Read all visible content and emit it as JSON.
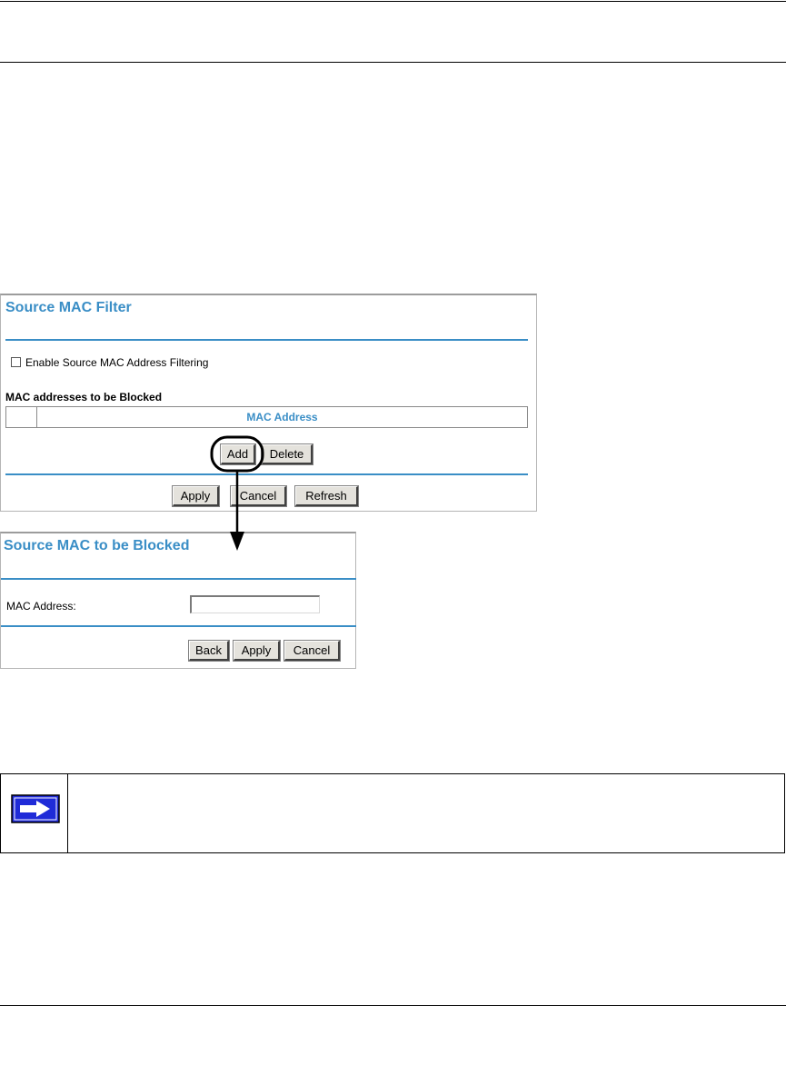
{
  "source_mac_filter": {
    "title": "Source MAC Filter",
    "enable_label": "Enable Source MAC Address Filtering",
    "enable_checked": false,
    "blocked_list_heading": "MAC addresses to be Blocked",
    "table_column": "MAC Address",
    "add_label": "Add",
    "delete_label": "Delete",
    "apply_label": "Apply",
    "cancel_label": "Cancel",
    "refresh_label": "Refresh"
  },
  "source_mac_blocked": {
    "title": "Source MAC to be Blocked",
    "mac_label": "MAC Address:",
    "mac_value": "",
    "back_label": "Back",
    "apply_label": "Apply",
    "cancel_label": "Cancel"
  },
  "colors": {
    "accent": "#3a8ec6",
    "button_face": "#e4e2dc",
    "note_icon": "#1f2bd8"
  },
  "icons": {
    "note": "right-arrow-note-icon"
  }
}
